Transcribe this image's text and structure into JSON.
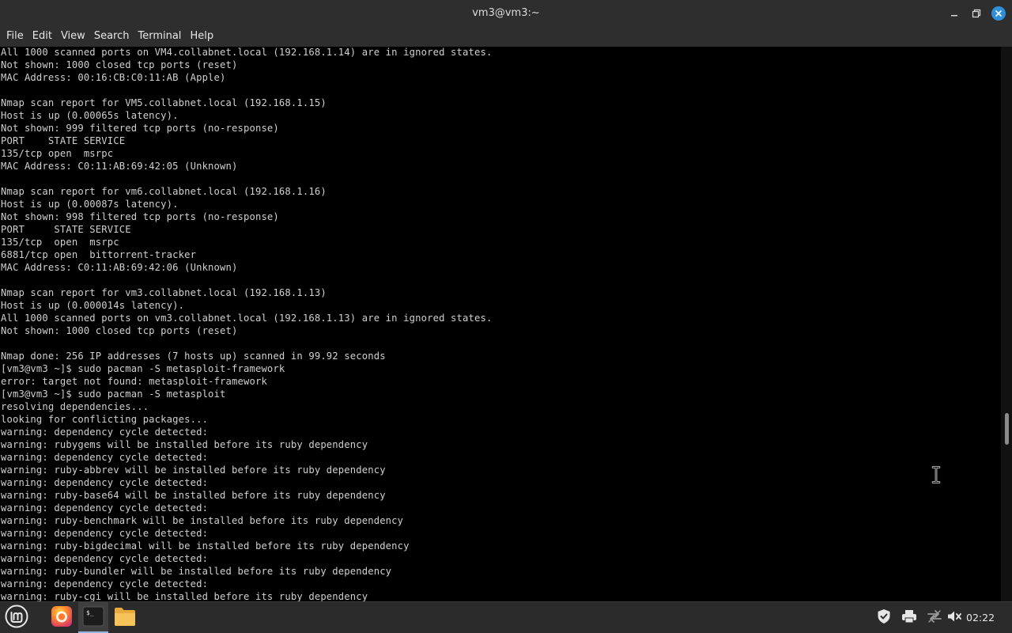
{
  "window": {
    "title": "vm3@vm3:~",
    "controls": {
      "minimize_icon": "minimize-icon",
      "maximize_icon": "maximize-icon",
      "close_icon": "close-icon"
    }
  },
  "menubar": {
    "items": [
      "File",
      "Edit",
      "View",
      "Search",
      "Terminal",
      "Help"
    ]
  },
  "terminal": {
    "lines": [
      "All 1000 scanned ports on VM4.collabnet.local (192.168.1.14) are in ignored states.",
      "Not shown: 1000 closed tcp ports (reset)",
      "MAC Address: 00:16:CB:C0:11:AB (Apple)",
      "",
      "Nmap scan report for VM5.collabnet.local (192.168.1.15)",
      "Host is up (0.00065s latency).",
      "Not shown: 999 filtered tcp ports (no-response)",
      "PORT    STATE SERVICE",
      "135/tcp open  msrpc",
      "MAC Address: C0:11:AB:69:42:05 (Unknown)",
      "",
      "Nmap scan report for vm6.collabnet.local (192.168.1.16)",
      "Host is up (0.00087s latency).",
      "Not shown: 998 filtered tcp ports (no-response)",
      "PORT     STATE SERVICE",
      "135/tcp  open  msrpc",
      "6881/tcp open  bittorrent-tracker",
      "MAC Address: C0:11:AB:69:42:06 (Unknown)",
      "",
      "Nmap scan report for vm3.collabnet.local (192.168.1.13)",
      "Host is up (0.000014s latency).",
      "All 1000 scanned ports on vm3.collabnet.local (192.168.1.13) are in ignored states.",
      "Not shown: 1000 closed tcp ports (reset)",
      "",
      "Nmap done: 256 IP addresses (7 hosts up) scanned in 99.92 seconds",
      "[vm3@vm3 ~]$ sudo pacman -S metasploit-framework",
      "error: target not found: metasploit-framework",
      "[vm3@vm3 ~]$ sudo pacman -S metasploit",
      "resolving dependencies...",
      "looking for conflicting packages...",
      "warning: dependency cycle detected:",
      "warning: rubygems will be installed before its ruby dependency",
      "warning: dependency cycle detected:",
      "warning: ruby-abbrev will be installed before its ruby dependency",
      "warning: dependency cycle detected:",
      "warning: ruby-base64 will be installed before its ruby dependency",
      "warning: dependency cycle detected:",
      "warning: ruby-benchmark will be installed before its ruby dependency",
      "warning: dependency cycle detected:",
      "warning: ruby-bigdecimal will be installed before its ruby dependency",
      "warning: dependency cycle detected:",
      "warning: ruby-bundler will be installed before its ruby dependency",
      "warning: dependency cycle detected:",
      "warning: ruby-cgi will be installed before its ruby dependency"
    ],
    "scroll_position": 0.62
  },
  "taskbar": {
    "launchers": [
      {
        "name": "menu",
        "icon": "linux-mint-menu-icon"
      },
      {
        "name": "firefox",
        "icon": "firefox-icon"
      },
      {
        "name": "terminal",
        "icon": "terminal-icon",
        "active": true
      },
      {
        "name": "files",
        "icon": "folder-icon"
      }
    ],
    "tray": [
      {
        "name": "update-manager",
        "icon": "shield-check-icon"
      },
      {
        "name": "printer",
        "icon": "printer-icon"
      },
      {
        "name": "network",
        "icon": "network-icon"
      },
      {
        "name": "volume",
        "icon": "volume-muted-icon"
      }
    ],
    "clock": "02:22"
  },
  "colors": {
    "titlebar_bg": "#2e2e2e",
    "terminal_bg": "#000000",
    "terminal_fg": "#d0d0d0",
    "taskbar_bg": "#2b2b2b",
    "close_button": "#2f8fd8",
    "active_indicator": "#8fb4e0"
  }
}
